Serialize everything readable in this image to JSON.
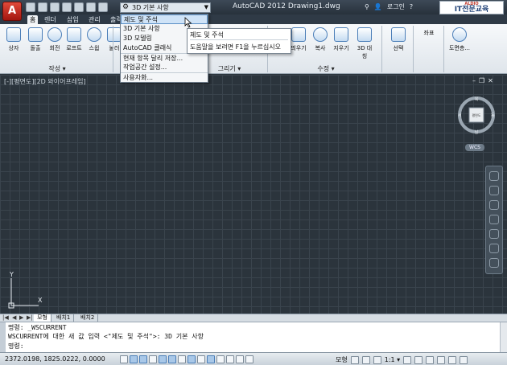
{
  "titlebar": {
    "logo": "A",
    "workspace_value": "3D 기본 사항",
    "title": "AutoCAD 2012    Drawing1.dwg",
    "login": "로그인",
    "brand_small": "ALDIO",
    "brand_main": "IT전문교육"
  },
  "ribbon": {
    "tabs": [
      {
        "label": "홈"
      },
      {
        "label": "렌더"
      },
      {
        "label": "삽입"
      },
      {
        "label": "관리"
      },
      {
        "label": "출력"
      }
    ],
    "buttons": [
      {
        "label": "상자"
      },
      {
        "label": "돌출"
      },
      {
        "label": "회전"
      },
      {
        "label": "로프트"
      },
      {
        "label": "스윕"
      },
      {
        "label": "눌러"
      },
      {
        "label": "띄우기"
      },
      {
        "label": "복사"
      },
      {
        "label": "지우기"
      },
      {
        "label": "3D 대칭"
      },
      {
        "label": "선택"
      },
      {
        "label": "좌표"
      },
      {
        "label": "도면층..."
      }
    ],
    "panels": {
      "create": "작성 ▾",
      "draw": "그리기 ▾",
      "modify": "수정 ▾"
    }
  },
  "workspace_menu": {
    "items": [
      {
        "label": "제도 및 주석"
      },
      {
        "label": "3D 기본 사항"
      },
      {
        "label": "3D 모델링"
      },
      {
        "label": "AutoCAD 클래식"
      },
      {
        "label": "현재 항목 달리 저장..."
      },
      {
        "label": "작업공간 설정..."
      },
      {
        "label": "사용자화..."
      }
    ],
    "highlighted_index": 0,
    "tooltip_title": "제도 및 주석",
    "tooltip_help": "도움말을 보려면 F1을 누르십시오"
  },
  "viewport": {
    "label": "[-][평면도][2D 와이어프레임]",
    "viewcube_face": "평면도",
    "compass": {
      "n": "북",
      "s": "남",
      "e": "동",
      "w": "서"
    },
    "wcs": "WCS",
    "ucs_x": "X",
    "ucs_y": "Y"
  },
  "layout_tabs": [
    {
      "label": "모형"
    },
    {
      "label": "배치1"
    },
    {
      "label": "배치2"
    }
  ],
  "command": {
    "line1": "명령: _WSCURRENT",
    "line2": "WSCURRENT에 대한 새 값 입력 <\"제도 및 주석\">: 3D 기본 사항",
    "prompt": "명령:"
  },
  "statusbar": {
    "coords": "2372.0198, 1825.0222, 0.0000",
    "model": "모형",
    "scale": "1:1 ▾"
  },
  "colors": {
    "canvas": "#2b343c",
    "grid": "#3a444d",
    "accent": "#4b7eb8",
    "logo_red": "#c0392b"
  }
}
